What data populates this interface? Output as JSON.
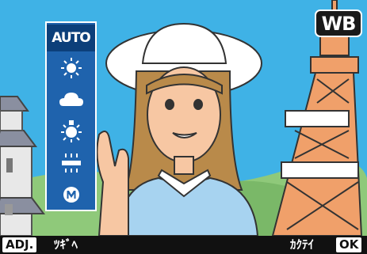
{
  "badge": {
    "label": "WB"
  },
  "wb_menu": {
    "selected": "AUTO",
    "items": [
      {
        "id": "auto",
        "label": "AUTO",
        "icon": null
      },
      {
        "id": "daylight",
        "label": "",
        "icon": "sun-icon"
      },
      {
        "id": "cloudy",
        "label": "",
        "icon": "cloud-icon"
      },
      {
        "id": "incandescent",
        "label": "",
        "icon": "incandescent-bulb-icon"
      },
      {
        "id": "fluorescent",
        "label": "",
        "icon": "fluorescent-tube-icon"
      },
      {
        "id": "manual",
        "label": "",
        "icon": "manual-m-icon"
      }
    ]
  },
  "bottom_bar": {
    "adj_key": "ADJ.",
    "next_label": "ﾂｷﾞﾍ",
    "confirm_label": "ｶｸﾃｲ",
    "ok_key": "OK"
  },
  "colors": {
    "sky": "#3fb2e6",
    "panel": "#1f63ad",
    "tower": "#f0a06a",
    "shirt": "#a7d3f0",
    "hair": "#b98a4a",
    "skin": "#f7c7a3",
    "grass": "#8fc97a"
  }
}
